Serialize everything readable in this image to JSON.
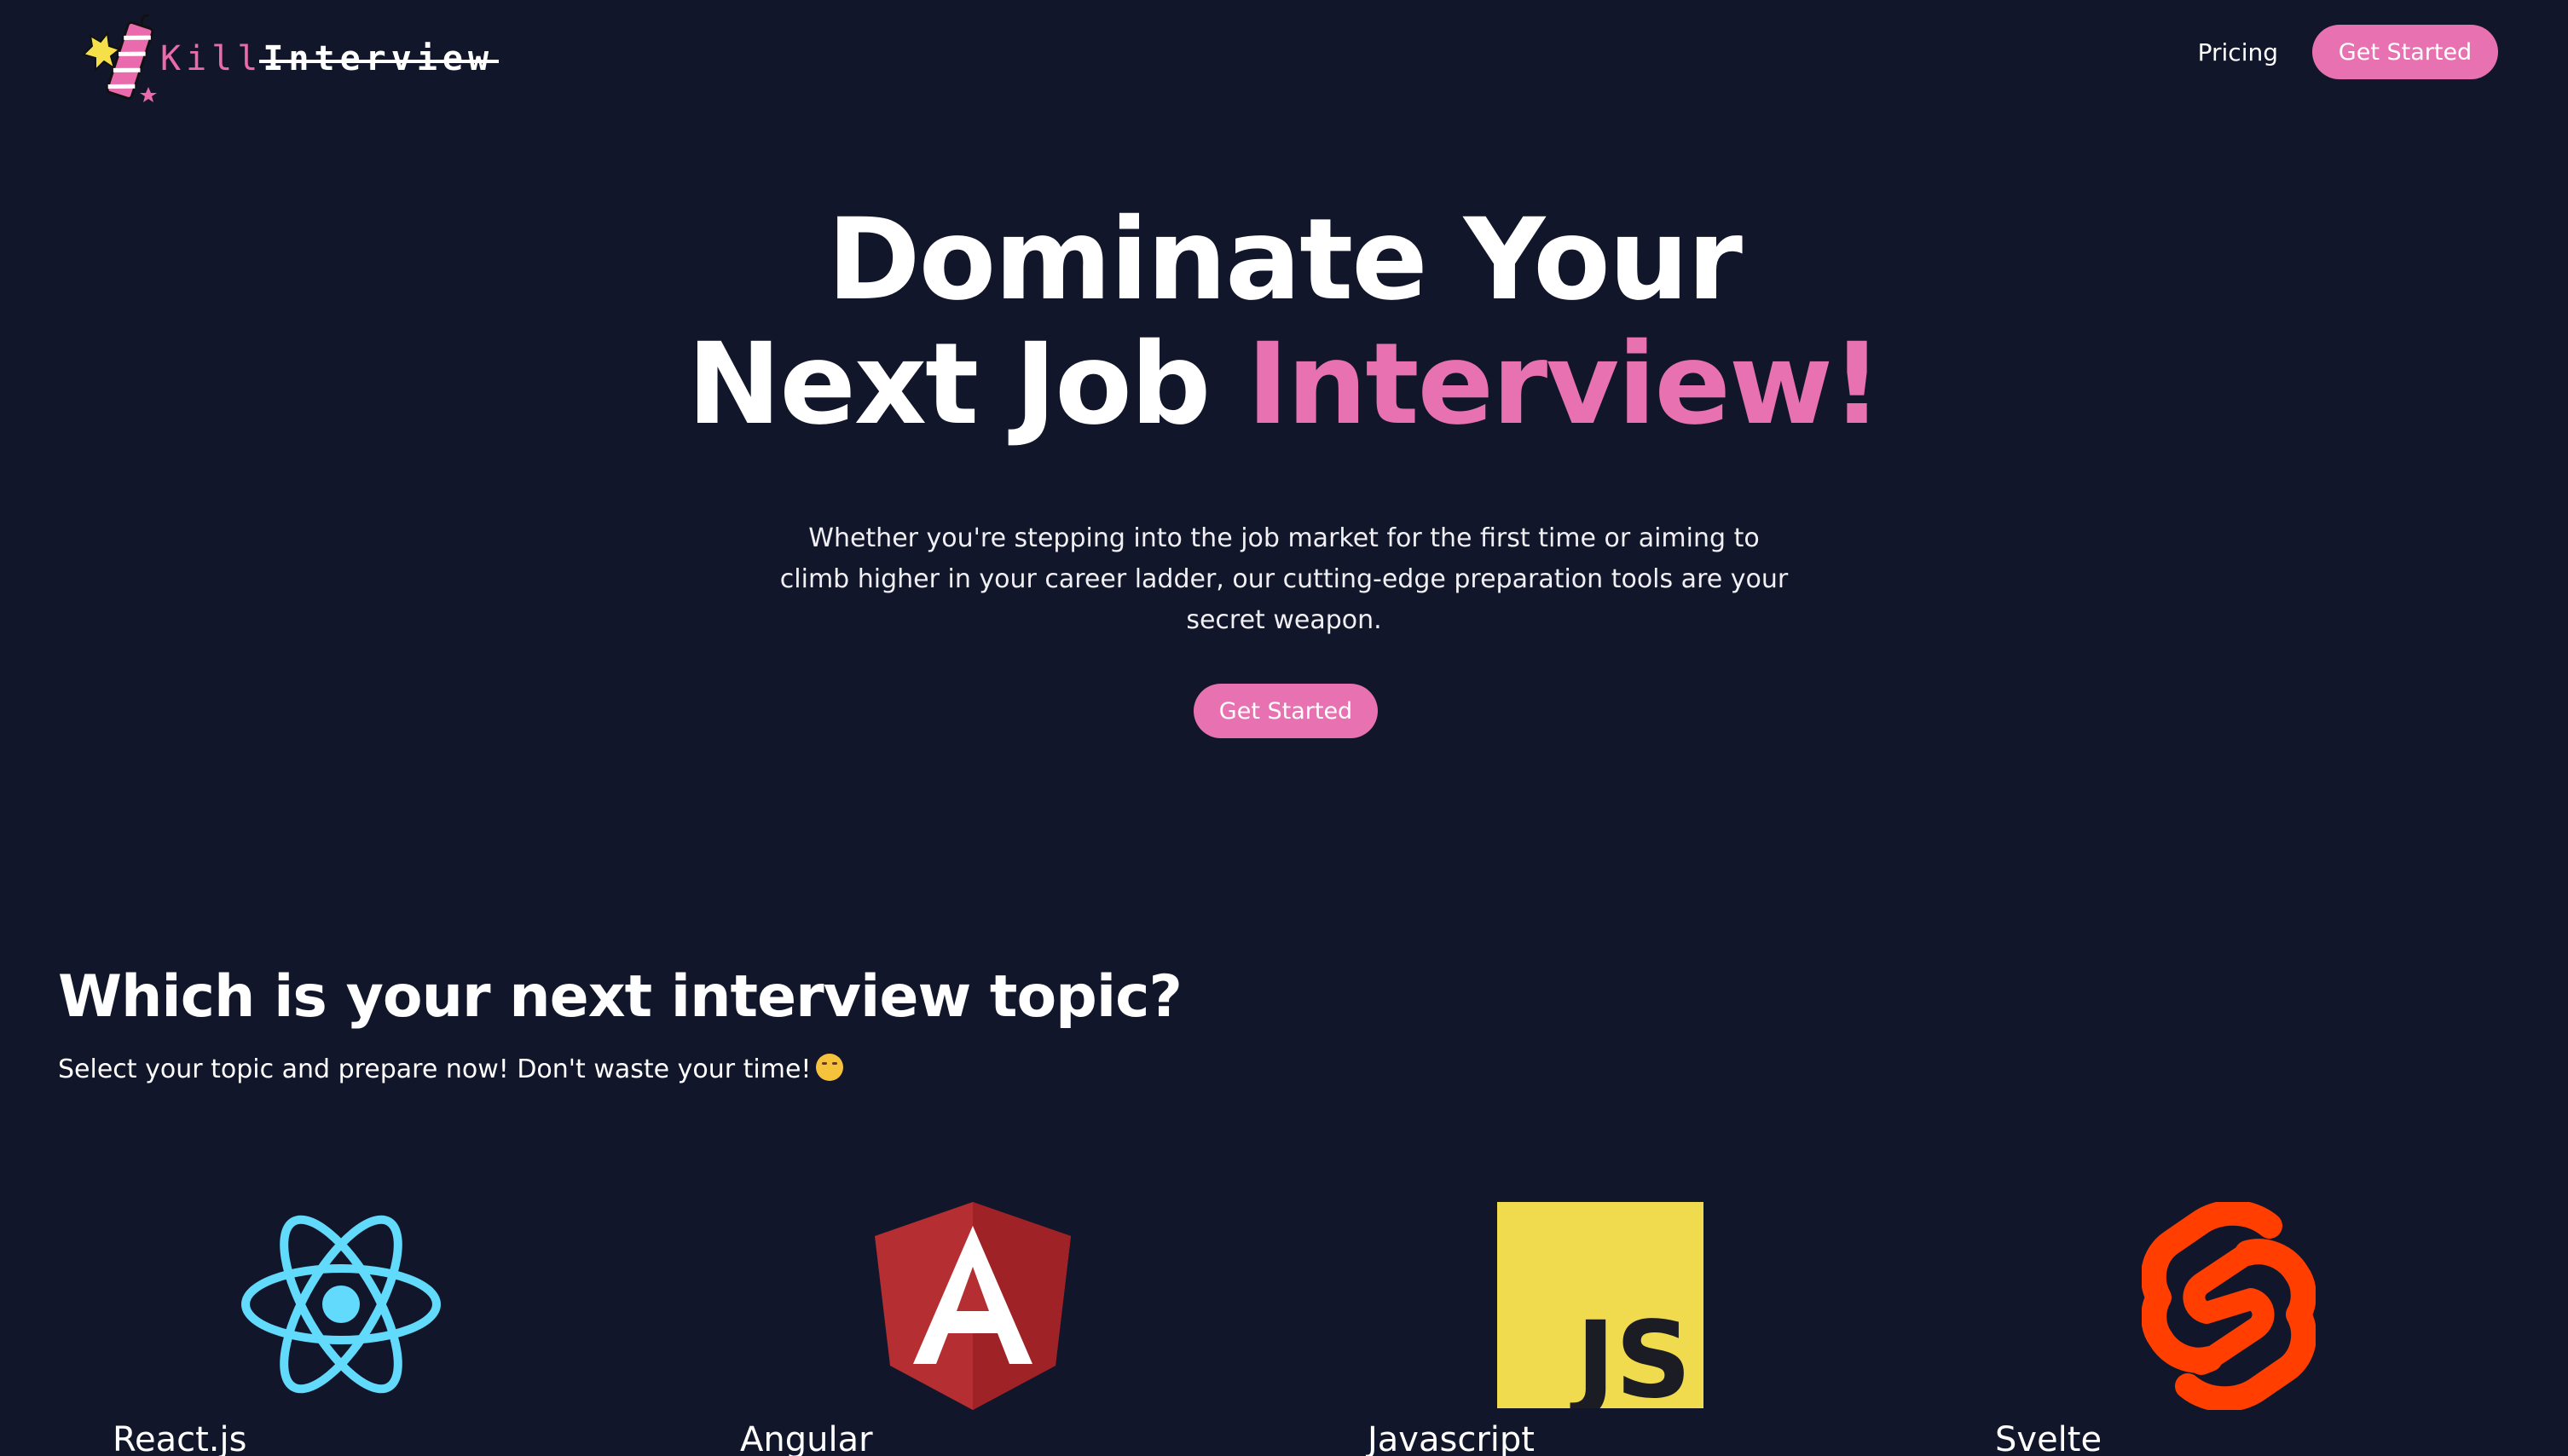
{
  "header": {
    "logo_kill": "Kill",
    "logo_interview": "Interview",
    "nav_pricing": "Pricing",
    "nav_cta": "Get Started"
  },
  "hero": {
    "title_line1": "Dominate Your",
    "title_line2_plain": "Next Job ",
    "title_line2_accent": "Interview!",
    "subtitle": "Whether you're stepping into the job market for the first time or aiming to climb higher in your career ladder, our cutting-edge preparation tools are your secret weapon.",
    "cta": "Get Started"
  },
  "topics": {
    "title": "Which is your next interview topic?",
    "subtitle": "Select your topic and prepare now! Don't waste your time!",
    "items": [
      {
        "label": "React.js",
        "icon": "react-icon"
      },
      {
        "label": "Angular",
        "icon": "angular-icon"
      },
      {
        "label": "Javascript",
        "icon": "javascript-icon"
      },
      {
        "label": "Svelte",
        "icon": "svelte-icon"
      }
    ]
  },
  "colors": {
    "background": "#12162a",
    "accent_pink": "#e872b1",
    "react": "#61dafb",
    "angular": "#b52e31",
    "javascript": "#f0db4f",
    "svelte": "#ff3e00"
  }
}
